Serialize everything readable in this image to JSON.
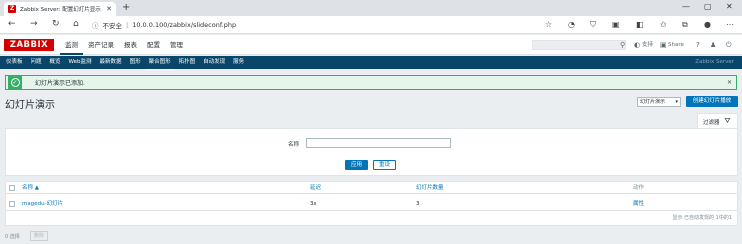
{
  "browser": {
    "tab_title": "Zabbix Server: 配置幻灯片显示",
    "favicon_letter": "Z",
    "url_warning": "不安全",
    "url": "10.0.0.100/zabbix/slideconf.php"
  },
  "zabbix": {
    "logo": "ZABBIX",
    "menu": [
      "监测",
      "资产记录",
      "报表",
      "配置",
      "管理"
    ],
    "active_menu": "监测",
    "support_label": "支持",
    "share_label": "Share",
    "help_label": "?",
    "submenu": [
      "仪表板",
      "问题",
      "概览",
      "Web监测",
      "最新数据",
      "图形",
      "聚合图形",
      "拓扑图",
      "自动发现",
      "服务"
    ],
    "active_submenu": "聚合图形",
    "server_name": "Zabbix Server"
  },
  "message": {
    "text": "幻灯片演示已添加."
  },
  "page": {
    "title": "幻灯片演示",
    "view_select": "幻灯片演示",
    "create_button": "创建幻灯片播放"
  },
  "filter": {
    "tab_label": "过滤器",
    "name_label": "名称",
    "name_value": "",
    "apply_button": "应用",
    "reset_button": "重设"
  },
  "table": {
    "headers": {
      "name": "名称 ▲",
      "delay": "延迟",
      "count": "幻灯片数量",
      "action": "动作"
    },
    "rows": [
      {
        "name": "magedu-幻灯片",
        "delay": "3s",
        "count": "3",
        "action": "属性"
      }
    ],
    "footer": "显示 已自动发现的 1中的1"
  },
  "bottom": {
    "selected": "0 选择",
    "delete_button": "删除"
  },
  "colors": {
    "brand": "#d40000",
    "nav": "#0a466a",
    "link": "#0275b8",
    "success": "#34af67"
  }
}
